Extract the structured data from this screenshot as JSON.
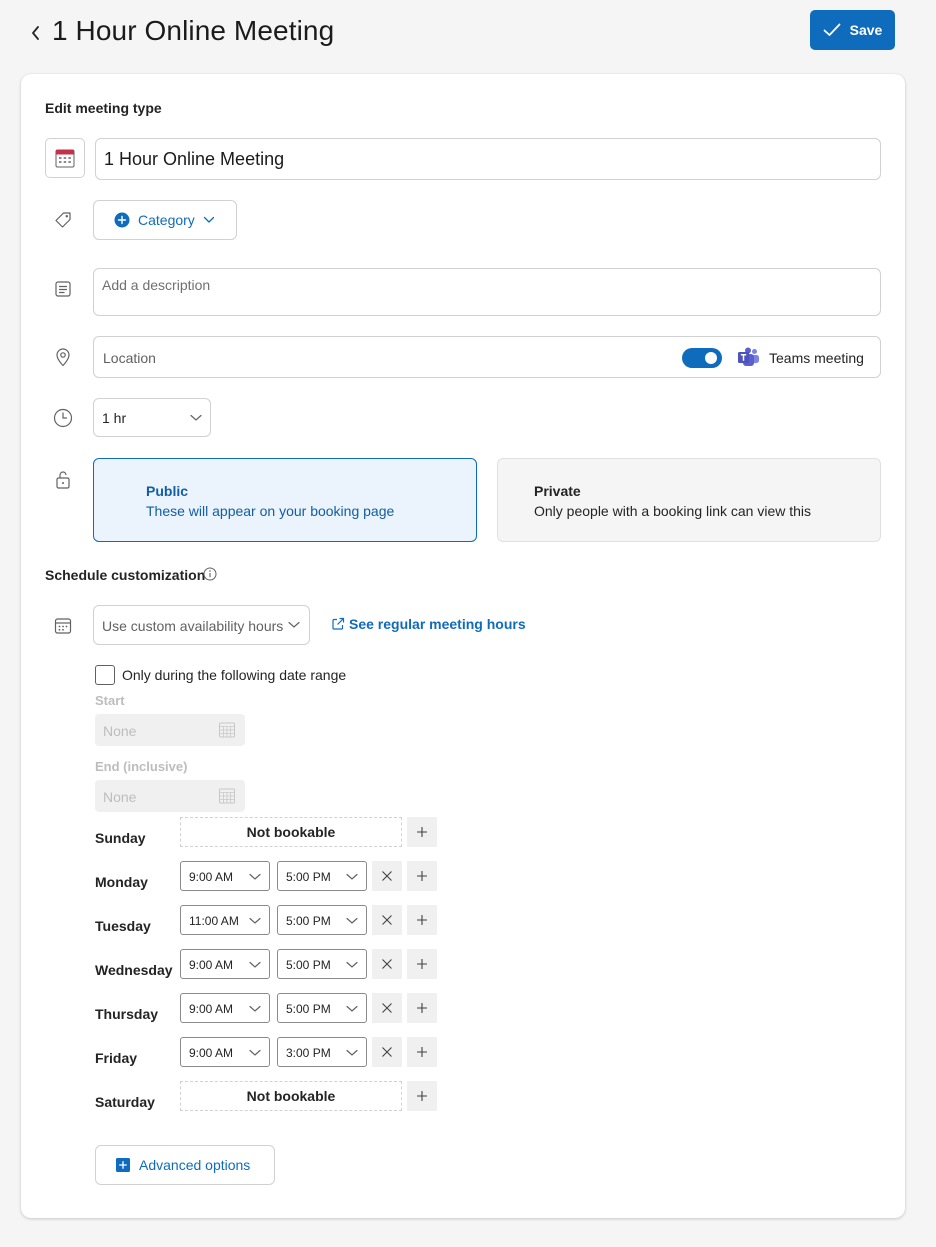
{
  "header": {
    "title": "1 Hour Online Meeting",
    "save_label": "Save"
  },
  "edit": {
    "section_title": "Edit meeting type",
    "name_value": "1 Hour Online Meeting",
    "category_label": "Category",
    "description_placeholder": "Add a description",
    "location_placeholder": "Location",
    "teams_toggle_on": true,
    "teams_label": "Teams meeting",
    "duration_value": "1 hr",
    "visibility": {
      "selected": "public",
      "public_title": "Public",
      "public_desc": "These will appear on your booking page",
      "private_title": "Private",
      "private_desc": "Only people with a booking link can view this"
    }
  },
  "schedule": {
    "section_title": "Schedule customization",
    "availability_value": "Use custom availability hours",
    "see_hours_link": "See regular meeting hours",
    "date_range_label": "Only during the following date range",
    "date_range_checked": false,
    "start_label": "Start",
    "start_value": "None",
    "end_label": "End (inclusive)",
    "end_value": "None",
    "not_bookable_label": "Not bookable",
    "days": [
      {
        "name": "Sunday",
        "bookable": false
      },
      {
        "name": "Monday",
        "bookable": true,
        "start": "9:00 AM",
        "end": "5:00 PM"
      },
      {
        "name": "Tuesday",
        "bookable": true,
        "start": "11:00 AM",
        "end": "5:00 PM"
      },
      {
        "name": "Wednesday",
        "bookable": true,
        "start": "9:00 AM",
        "end": "5:00 PM"
      },
      {
        "name": "Thursday",
        "bookable": true,
        "start": "9:00 AM",
        "end": "5:00 PM"
      },
      {
        "name": "Friday",
        "bookable": true,
        "start": "9:00 AM",
        "end": "3:00 PM"
      },
      {
        "name": "Saturday",
        "bookable": false
      }
    ],
    "advanced_label": "Advanced options"
  },
  "colors": {
    "accent": "#0f6cbd",
    "public_bg": "#ebf3fc",
    "teams_purple": "#5b5fc7"
  }
}
